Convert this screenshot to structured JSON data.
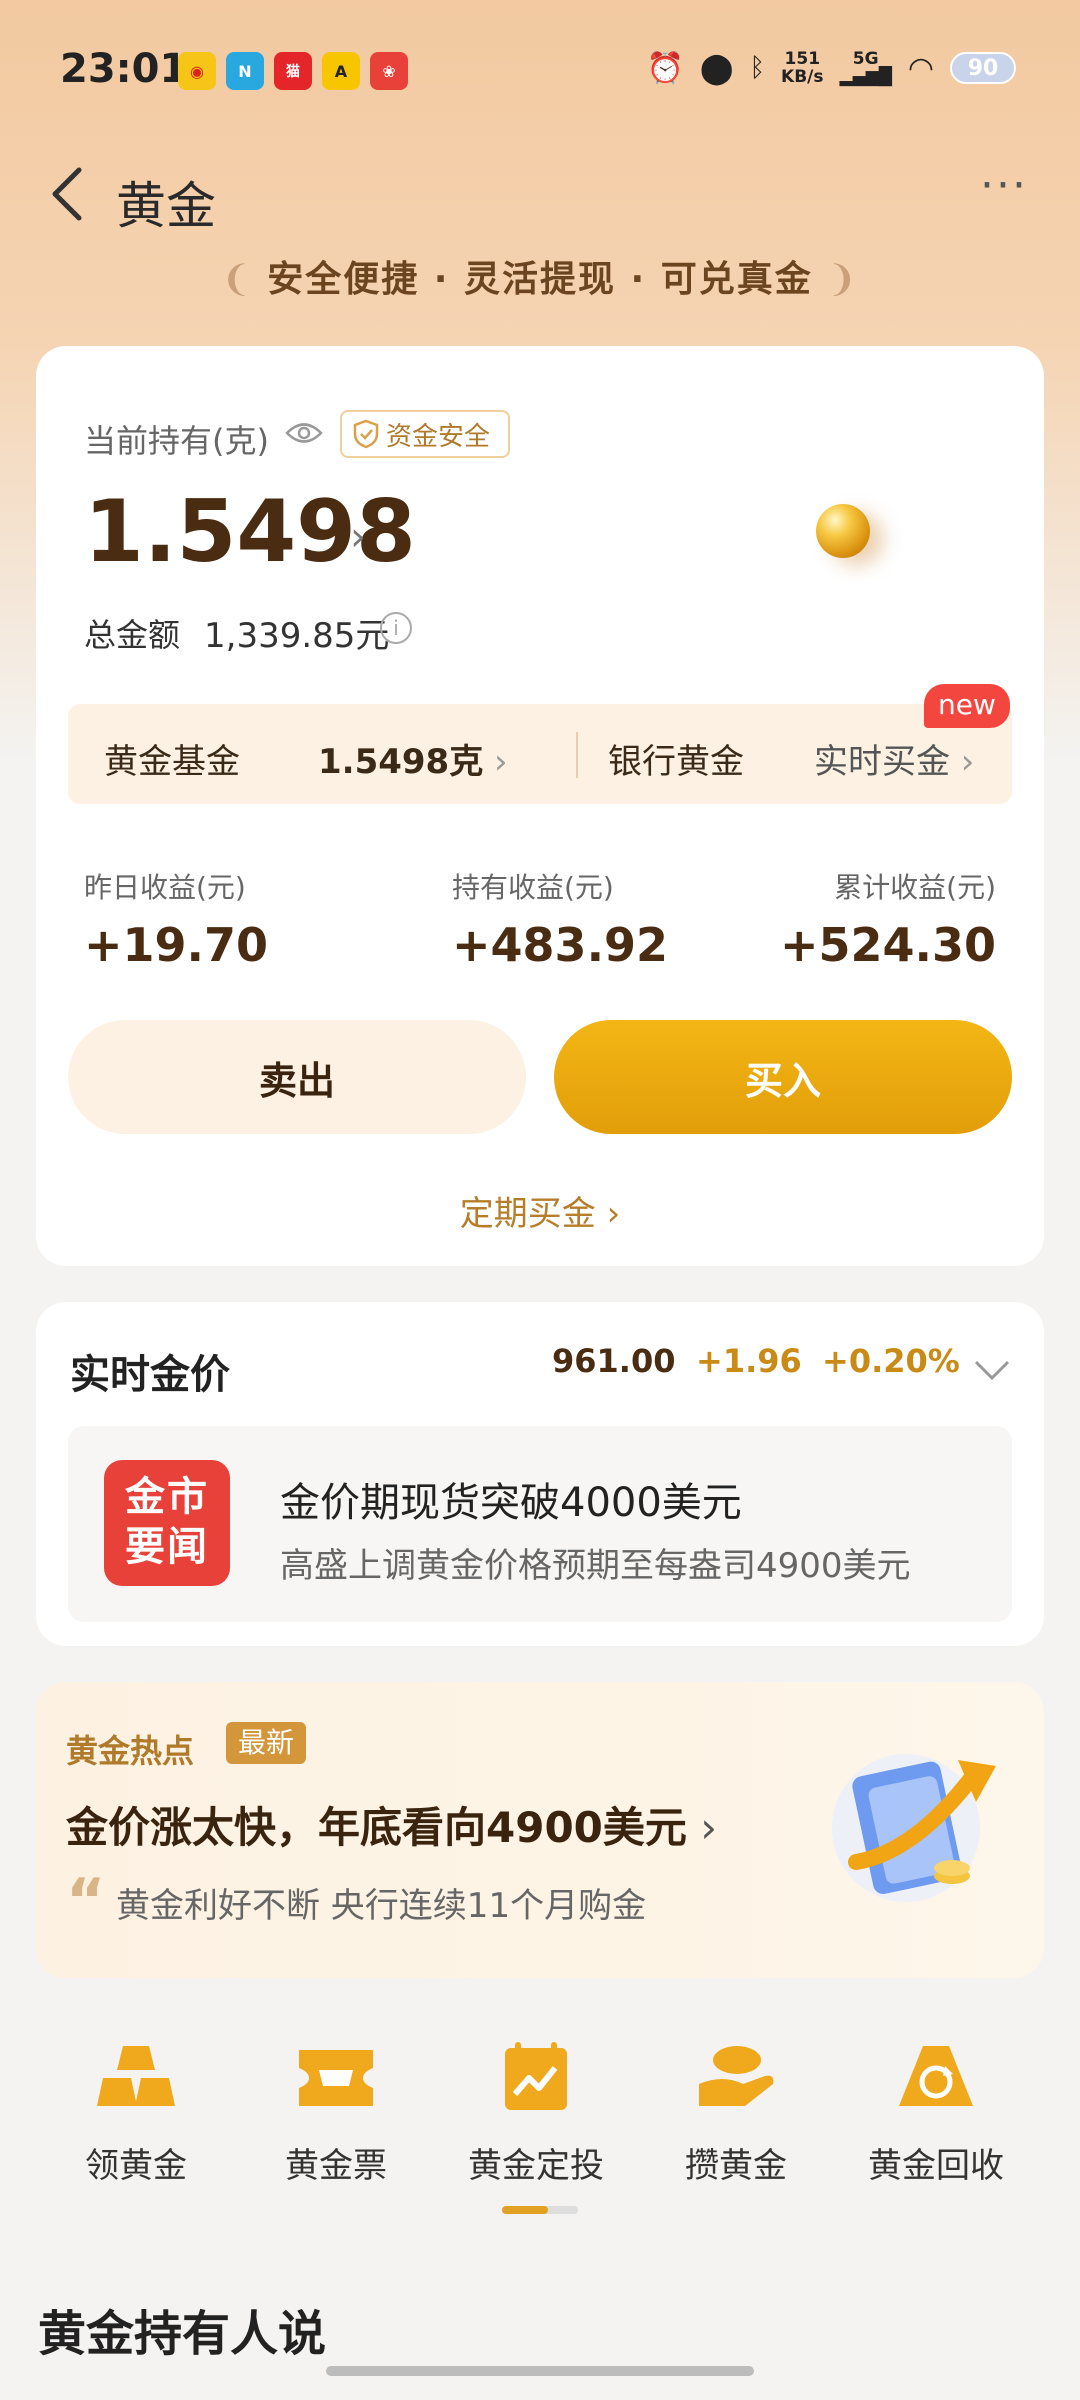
{
  "status_bar": {
    "time": "23:01",
    "net_speed_value": "151",
    "net_speed_unit": "KB/s",
    "network": "5G",
    "battery": "90"
  },
  "nav": {
    "title": "黄金",
    "tagline": "安全便捷 · 灵活提现 · 可兑真金"
  },
  "holding": {
    "label": "当前持有(克)",
    "safe_badge": "资金安全",
    "amount": "1.5498",
    "total_label": "总金额",
    "total_value": "1,339.85元",
    "sub_items": {
      "fund_label": "黄金基金",
      "fund_value": "1.5498克",
      "bank_label": "银行黄金",
      "realtime_label": "实时买金",
      "new_tag": "new"
    },
    "profits": [
      {
        "label": "昨日收益(元)",
        "value": "+19.70"
      },
      {
        "label": "持有收益(元)",
        "value": "+483.92"
      },
      {
        "label": "累计收益(元)",
        "value": "+524.30"
      }
    ],
    "sell_label": "卖出",
    "buy_label": "买入",
    "regular_buy": "定期买金"
  },
  "price": {
    "title": "实时金价",
    "value": "961.00",
    "change": "+1.96",
    "change_pct": "+0.20%",
    "news_logo": "金市要闻",
    "news_logo_line1": "金市",
    "news_logo_line2": "要闻",
    "news_title": "金价期现货突破4000美元",
    "news_sub": "高盛上调黄金价格预期至每盎司4900美元"
  },
  "hot": {
    "title": "黄金热点",
    "badge": "最新",
    "headline": "金价涨太快，年底看向4900美元",
    "sub": "黄金利好不断 央行连续11个月购金"
  },
  "shortcuts": [
    {
      "label": "领黄金",
      "icon": "gold-bars-icon"
    },
    {
      "label": "黄金票",
      "icon": "gold-ticket-icon"
    },
    {
      "label": "黄金定投",
      "icon": "calendar-chart-icon"
    },
    {
      "label": "攒黄金",
      "icon": "hand-gold-icon"
    },
    {
      "label": "黄金回收",
      "icon": "recycle-gold-icon"
    }
  ],
  "section_title": "黄金持有人说",
  "colors": {
    "accent_gold": "#e2a024",
    "text_brown": "#4a2c12",
    "news_red": "#e8413a",
    "new_tag_red": "#f2463f"
  }
}
